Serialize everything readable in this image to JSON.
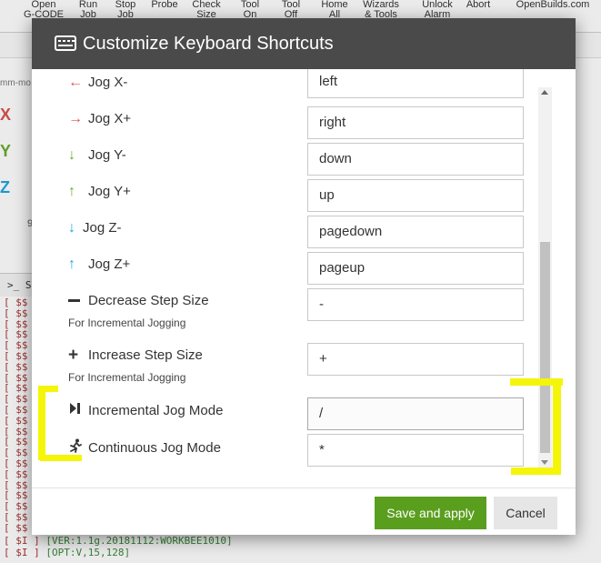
{
  "background": {
    "toolbar": [
      {
        "label": "Open\nG-CODE"
      },
      {
        "label": "Run\nJob"
      },
      {
        "label": "Stop\nJob"
      },
      {
        "label": "Probe"
      },
      {
        "label": "Check\nSize"
      },
      {
        "label": "Tool\nOn"
      },
      {
        "label": "Tool\nOff"
      },
      {
        "label": "Home\nAll"
      },
      {
        "label": "Wizards\n& Tools"
      },
      {
        "label": "Unlock\nAlarm"
      },
      {
        "label": "Abort"
      },
      {
        "label": "OpenBuilds.com"
      }
    ],
    "axes": {
      "x": "X",
      "y": "Y",
      "z": "Z"
    },
    "file_fragment": "mm-mo",
    "number_fragment": "9",
    "terminal_tab": ">_ S",
    "terminal_prefix": "[ $$",
    "terminal_last_lines": [
      {
        "tag": "[ $I ]",
        "text": "[VER:1.1g.20181112:WORKBEE1010]"
      },
      {
        "tag": "[ $I ]",
        "text": "[OPT:V,15,128]"
      }
    ]
  },
  "modal": {
    "title": "Customize Keyboard Shortcuts",
    "title_icon": "keyboard-icon",
    "rows": [
      {
        "label": "Jog X-",
        "value": "left",
        "icon": "arrow-left-icon",
        "color": "#d9534f"
      },
      {
        "label": "Jog X+",
        "value": "right",
        "icon": "arrow-right-icon",
        "color": "#d9534f"
      },
      {
        "label": "Jog Y-",
        "value": "down",
        "icon": "arrow-down-icon",
        "color": "#6aaa2e"
      },
      {
        "label": "Jog Y+",
        "value": "up",
        "icon": "arrow-up-icon",
        "color": "#6aaa2e"
      },
      {
        "label": "Jog Z-",
        "value": "pagedown",
        "icon": "arrow-down-icon",
        "color": "#1fa6e0"
      },
      {
        "label": "Jog Z+",
        "value": "pageup",
        "icon": "arrow-up-icon",
        "color": "#1fa6e0"
      },
      {
        "label": "Decrease Step Size",
        "sublabel": "For Incremental Jogging",
        "value": "-",
        "icon": "minus-icon",
        "color": "#333333"
      },
      {
        "label": "Increase Step Size",
        "sublabel": "For Incremental Jogging",
        "value": "+",
        "icon": "plus-icon",
        "color": "#333333"
      },
      {
        "label": "Incremental Jog Mode",
        "value": "/",
        "icon": "step-forward-icon",
        "color": "#333333"
      },
      {
        "label": "Continuous Jog Mode",
        "value": "*",
        "icon": "running-icon",
        "color": "#333333"
      }
    ],
    "footer": {
      "save_label": "Save and apply",
      "cancel_label": "Cancel"
    }
  },
  "colors": {
    "header": "#4a4a4a",
    "save_button": "#5a9e1e",
    "highlight_annotation": "#f5f50a"
  }
}
